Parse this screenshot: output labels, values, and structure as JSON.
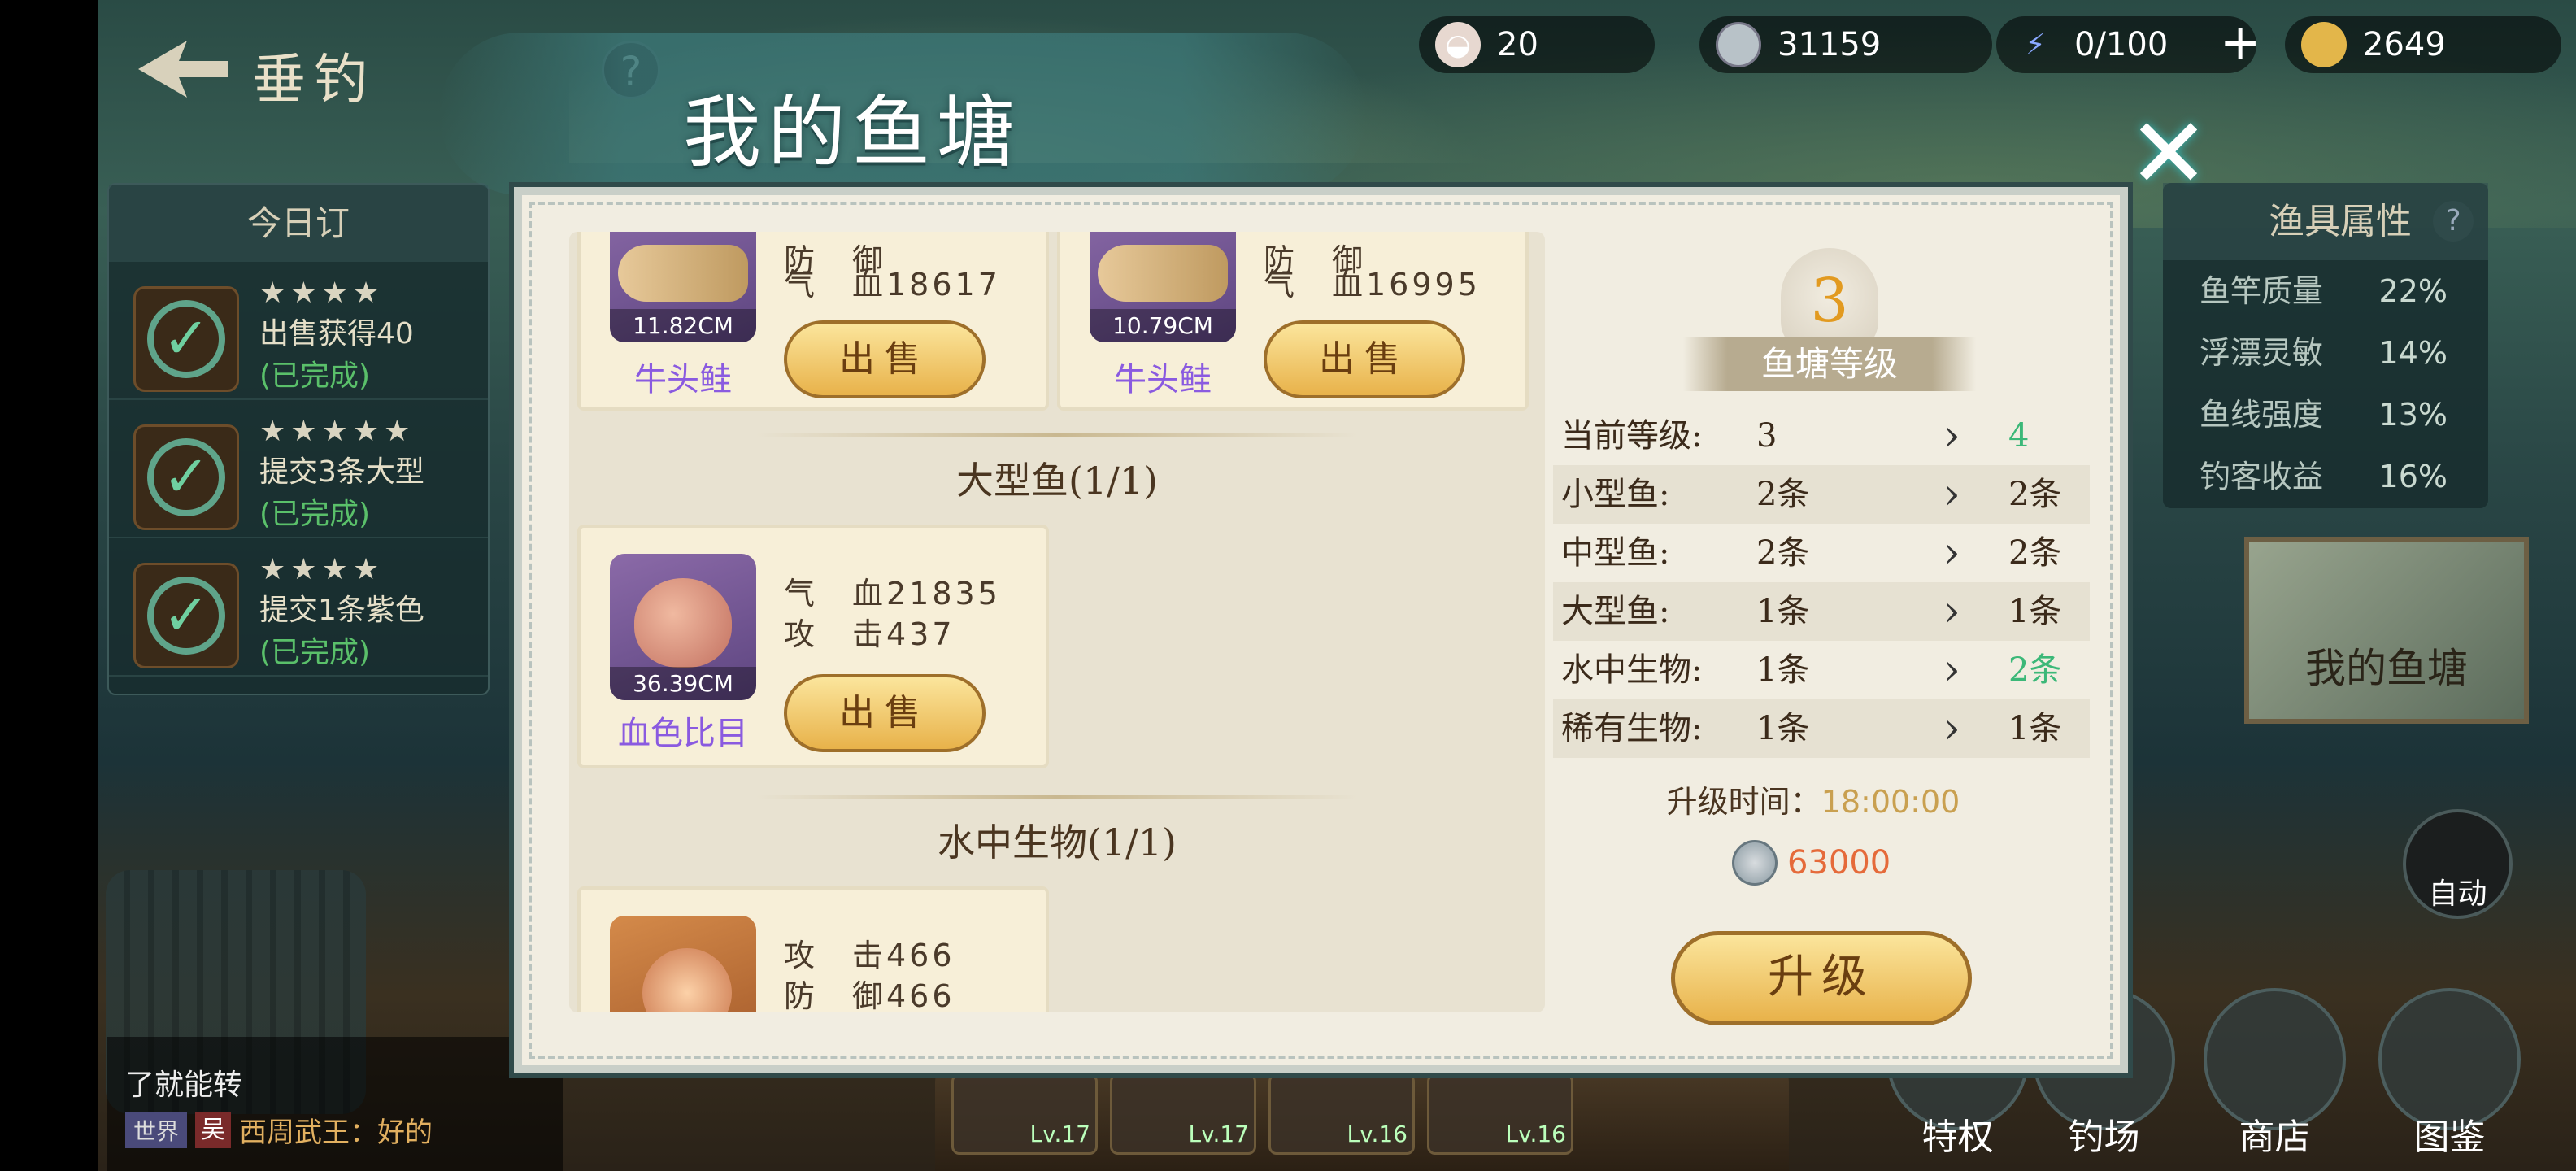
{
  "header": {
    "title": "垂钓",
    "help": "?"
  },
  "resources": [
    {
      "name": "pearl",
      "value": "20",
      "icon": "pearl-icon"
    },
    {
      "name": "silver",
      "value": "31159",
      "icon": "silver-coin-icon"
    },
    {
      "name": "energy",
      "value": "0/100",
      "icon": "lightning-icon"
    },
    {
      "name": "gold",
      "value": "2649",
      "icon": "gold-ingot-icon"
    }
  ],
  "plus": "+",
  "daily": {
    "title": "今日订",
    "tasks": [
      {
        "stars": "★★★★",
        "text": "出售获得40",
        "status": "(已完成)"
      },
      {
        "stars": "★★★★★",
        "text": "提交3条大型",
        "status": "(已完成)"
      },
      {
        "stars": "★★★★",
        "text": "提交1条紫色",
        "status": "(已完成)"
      }
    ]
  },
  "gear": {
    "title": "渔具属性",
    "help": "?",
    "rows": [
      {
        "k": "鱼竿质量",
        "v": "22%"
      },
      {
        "k": "浮漂灵敏",
        "v": "14%"
      },
      {
        "k": "鱼线强度",
        "v": "13%"
      },
      {
        "k": "钓客收益",
        "v": "16%"
      }
    ]
  },
  "side_buttons": {
    "pond": "我的鱼塘",
    "auto": "自动"
  },
  "bottom_menu": [
    "特权",
    "钓场",
    "商店",
    "图鉴"
  ],
  "slots": [
    "Lv.17",
    "Lv.17",
    "Lv.16",
    "Lv.16"
  ],
  "chat": {
    "line1": "了就能转",
    "channel": "世界",
    "avatar": "吴",
    "line2": "西周武王：好的"
  },
  "panel": {
    "title": "我的鱼塘",
    "close": "✕",
    "sell_label": "出售",
    "cards_top": [
      {
        "name": "牛头鲑",
        "size": "11.82CM",
        "stat1": "防　御",
        "stat2": "气　血18617"
      },
      {
        "name": "牛头鲑",
        "size": "10.79CM",
        "stat1": "防　御",
        "stat2": "气　血16995"
      }
    ],
    "section_large": "大型鱼(1/1)",
    "card_large": {
      "name": "血色比目",
      "size": "36.39CM",
      "stat1": "气　血21835",
      "stat2": "攻　击437"
    },
    "section_water": "水中生物(1/1)",
    "card_water": {
      "stat1": "攻　击466",
      "stat2": "防　御466"
    },
    "level": "3",
    "level_label": "鱼塘等级",
    "upgrade_rows": [
      {
        "k": "当前等级:",
        "a": "3",
        "b": "4",
        "b_green": true
      },
      {
        "k": "小型鱼:",
        "a": "2条",
        "b": "2条",
        "b_green": false
      },
      {
        "k": "中型鱼:",
        "a": "2条",
        "b": "2条",
        "b_green": false
      },
      {
        "k": "大型鱼:",
        "a": "1条",
        "b": "1条",
        "b_green": false
      },
      {
        "k": "水中生物:",
        "a": "1条",
        "b": "2条",
        "b_green": true
      },
      {
        "k": "稀有生物:",
        "a": "1条",
        "b": "1条",
        "b_green": false
      }
    ],
    "upgrade_time_label": "升级时间：",
    "upgrade_time": "18:00:00",
    "cost": "63000",
    "upgrade_button": "升级"
  }
}
